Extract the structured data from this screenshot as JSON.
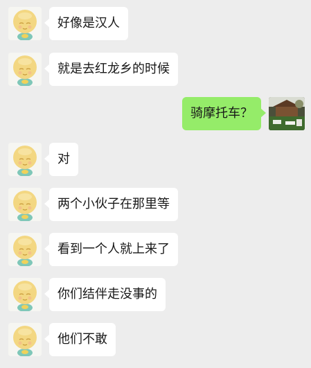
{
  "colors": {
    "background": "#ededed",
    "bubble_incoming": "#ffffff",
    "bubble_outgoing": "#95ec69",
    "text": "#191919"
  },
  "messages": [
    {
      "side": "left",
      "avatar": "cartoon-face-avatar-icon",
      "text": "好像是汉人"
    },
    {
      "side": "left",
      "avatar": "cartoon-face-avatar-icon",
      "text": "就是去红龙乡的时候"
    },
    {
      "side": "right",
      "avatar": "scene-photo-avatar-icon",
      "text": "骑摩托车？"
    },
    {
      "side": "left",
      "avatar": "cartoon-face-avatar-icon",
      "text": "对"
    },
    {
      "side": "left",
      "avatar": "cartoon-face-avatar-icon",
      "text": "两个小伙子在那里等"
    },
    {
      "side": "left",
      "avatar": "cartoon-face-avatar-icon",
      "text": "看到一个人就上来了"
    },
    {
      "side": "left",
      "avatar": "cartoon-face-avatar-icon",
      "text": "你们结伴走没事的"
    },
    {
      "side": "left",
      "avatar": "cartoon-face-avatar-icon",
      "text": "他们不敢"
    }
  ]
}
